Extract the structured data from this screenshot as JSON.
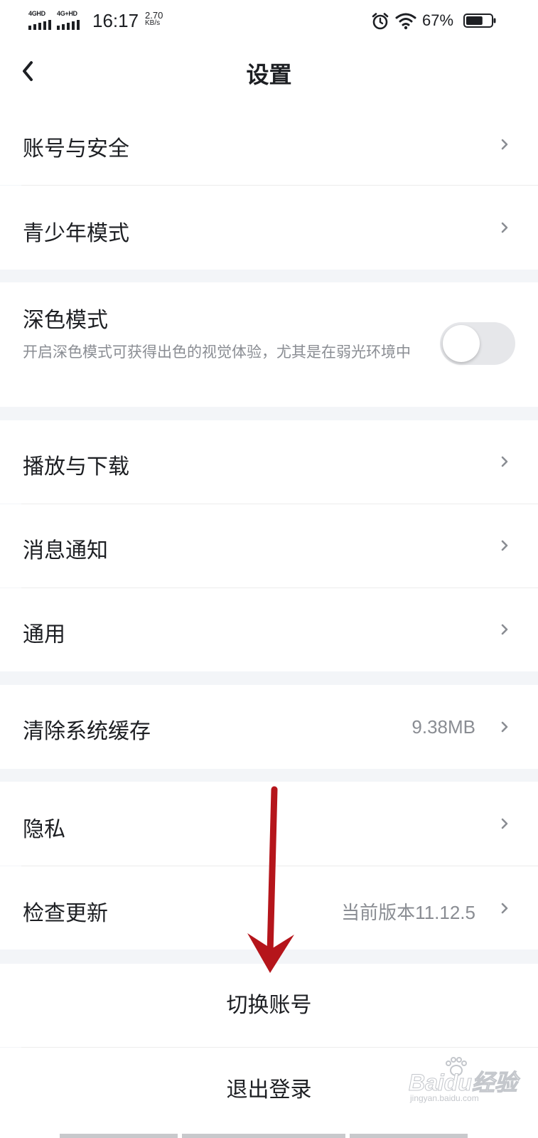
{
  "status_bar": {
    "signal_1": "4GHD",
    "signal_2": "4G+HD",
    "time": "16:17",
    "net_speed_value": "2.70",
    "net_speed_unit": "KB/s",
    "battery_percent": "67%",
    "battery_level": 0.67,
    "icons": [
      "alarm-icon",
      "wifi-icon",
      "battery-icon"
    ]
  },
  "header": {
    "title": "设置",
    "back_icon": "chevron-left-icon"
  },
  "settings": {
    "account_security": "账号与安全",
    "teen_mode": "青少年模式",
    "dark_mode": {
      "label": "深色模式",
      "description": "开启深色模式可获得出色的视觉体验，尤其是在弱光环境中",
      "enabled": false
    },
    "play_download": "播放与下载",
    "notifications": "消息通知",
    "general": "通用",
    "clear_cache": {
      "label": "清除系统缓存",
      "value": "9.38MB"
    },
    "privacy": "隐私",
    "check_update": {
      "label": "检查更新",
      "value": "当前版本11.12.5"
    }
  },
  "actions": {
    "switch_account": "切换账号",
    "logout": "退出登录"
  },
  "watermark": {
    "text": "Baidu经验",
    "url": "jingyan.baidu.com"
  },
  "colors": {
    "background": "#f3f5f8",
    "surface": "#ffffff",
    "text_primary": "#1d1f23",
    "text_secondary": "#8a8d93",
    "annotation_arrow": "#b5151b",
    "toggle_off": "#e6e7ea"
  }
}
